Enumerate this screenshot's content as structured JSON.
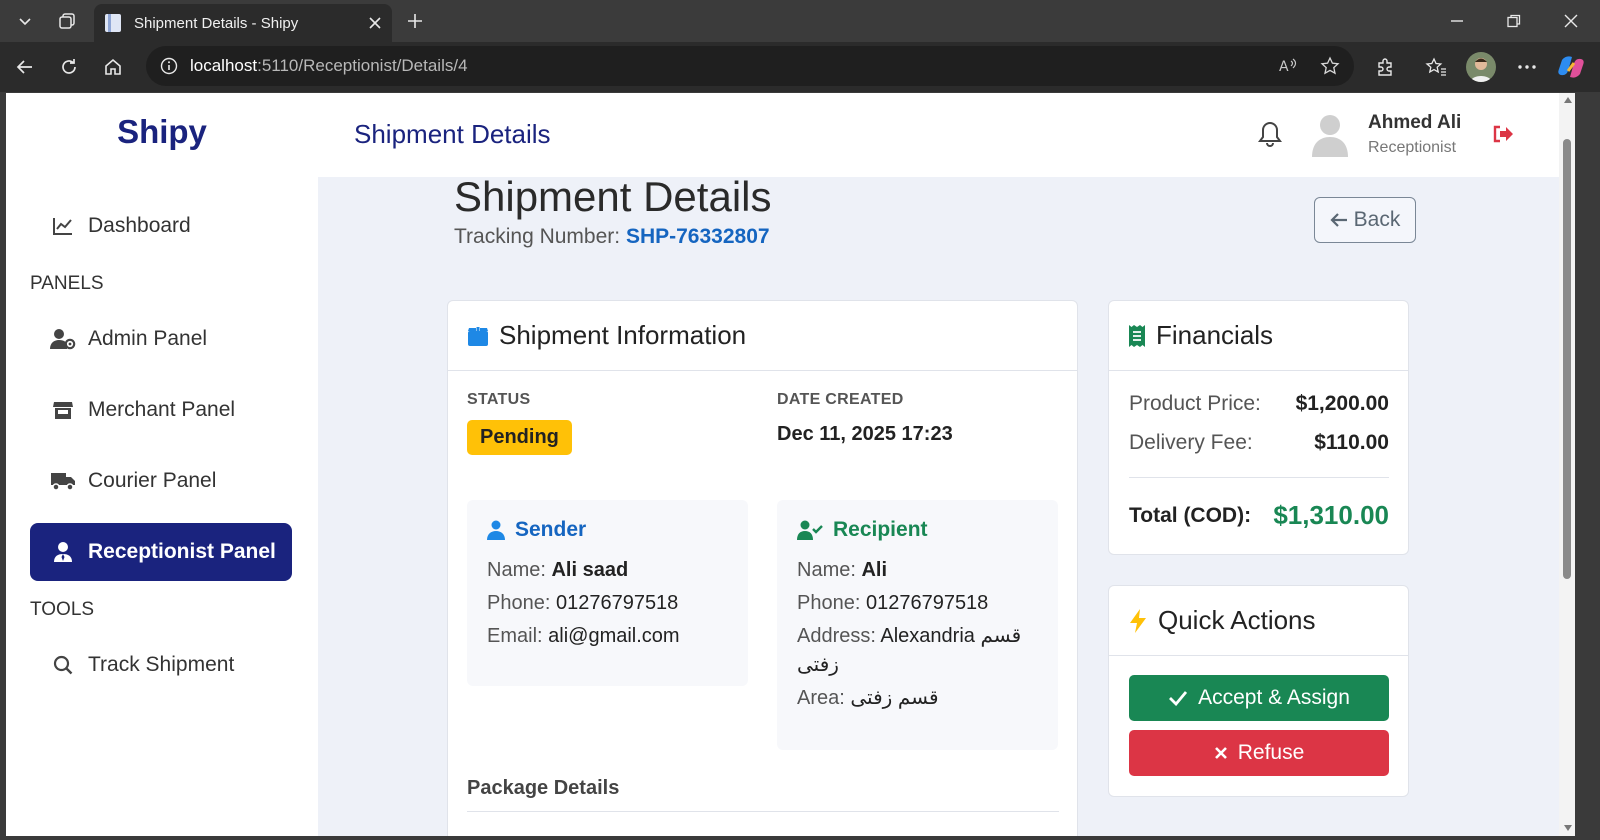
{
  "browser": {
    "tab_title": "Shipment Details - Shipy",
    "url_host": "localhost",
    "url_rest": ":5110/Receptionist/Details/4"
  },
  "sidebar": {
    "brand": "Shipy",
    "dashboard": "Dashboard",
    "panels_label": "PANELS",
    "admin": "Admin Panel",
    "merchant": "Merchant Panel",
    "courier": "Courier Panel",
    "receptionist": "Receptionist Panel",
    "tools_label": "TOOLS",
    "track": "Track Shipment"
  },
  "topbar": {
    "title": "Shipment Details",
    "user_name": "Ahmed Ali",
    "user_role": "Receptionist"
  },
  "main": {
    "title": "Shipment Details",
    "tracking_label": "Tracking Number:",
    "tracking_number": "SHP-76332807",
    "back_label": "Back"
  },
  "info": {
    "title": "Shipment Information",
    "status_label": "STATUS",
    "status_value": "Pending",
    "date_label": "DATE CREATED",
    "date_value": "Dec 11, 2025 17:23",
    "sender": {
      "title": "Sender",
      "name_label": "Name:",
      "name": "Ali saad",
      "phone_label": "Phone:",
      "phone": "01276797518",
      "email_label": "Email:",
      "email": "ali@gmail.com"
    },
    "recipient": {
      "title": "Recipient",
      "name_label": "Name:",
      "name": "Ali",
      "phone_label": "Phone:",
      "phone": "01276797518",
      "address_label": "Address:",
      "address": "Alexandria قسم زفتى",
      "area_label": "Area:",
      "area": "قسم زفتى"
    },
    "package_title": "Package Details"
  },
  "financials": {
    "title": "Financials",
    "product_label": "Product Price:",
    "product_value": "$1,200.00",
    "delivery_label": "Delivery Fee:",
    "delivery_value": "$110.00",
    "total_label": "Total (COD):",
    "total_value": "$1,310.00"
  },
  "quick_actions": {
    "title": "Quick Actions",
    "accept": "Accept & Assign",
    "refuse": "Refuse"
  },
  "colors": {
    "brand_navy": "#1a237e",
    "link_blue": "#1565c0",
    "success_green": "#198754",
    "danger_red": "#dc3545",
    "warning_yellow": "#ffc107"
  }
}
